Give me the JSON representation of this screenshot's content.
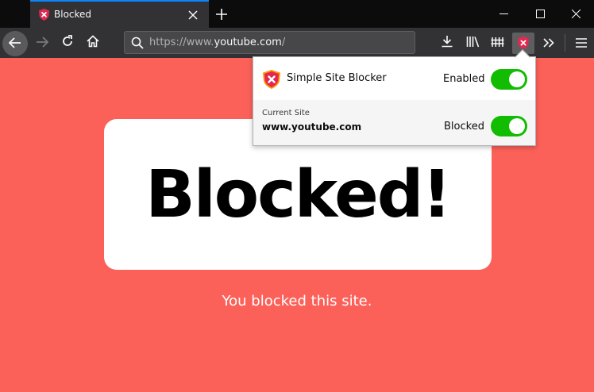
{
  "tab": {
    "title": "Blocked",
    "favicon": "shield-x-icon"
  },
  "window_controls": [
    "minimize-icon",
    "maximize-icon",
    "close-icon"
  ],
  "navbar": {
    "url_prefix": "https://www.",
    "url_host": "youtube.com",
    "url_suffix": "/",
    "icons": [
      "back-icon",
      "forward-icon",
      "reload-icon",
      "home-icon",
      "download-icon",
      "library-icon",
      "fence-icon",
      "extension-shield-icon",
      "overflow-icon",
      "menu-icon"
    ]
  },
  "page": {
    "heading": "Blocked!",
    "subtext": "You blocked this site."
  },
  "popup": {
    "extension_name": "Simple Site Blocker",
    "enabled_label": "Enabled",
    "enabled_on": true,
    "current_site_label": "Current Site",
    "current_site_value": "www.youtube.com",
    "blocked_label": "Blocked",
    "blocked_on": true
  },
  "colors": {
    "page_bg": "#fc6159",
    "toggle_on": "#12bc00",
    "shield_red": "#e22850",
    "shield_orange": "#ff9400",
    "tab_accent": "#0a84ff"
  }
}
